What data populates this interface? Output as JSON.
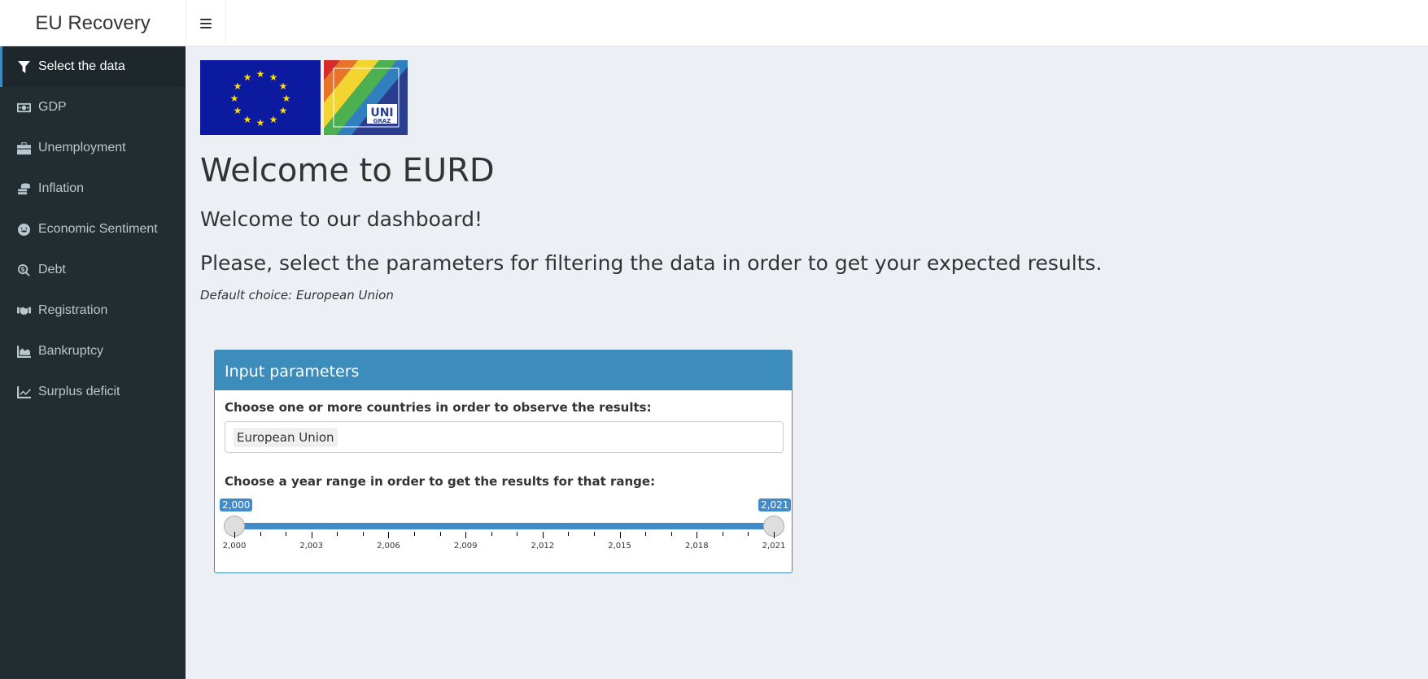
{
  "header": {
    "app_title": "EU Recovery",
    "toggle_icon": "hamburger-icon"
  },
  "sidebar": {
    "items": [
      {
        "label": "Select the data",
        "icon": "filter-icon",
        "active": true
      },
      {
        "label": "GDP",
        "icon": "money-icon",
        "active": false
      },
      {
        "label": "Unemployment",
        "icon": "briefcase-icon",
        "active": false
      },
      {
        "label": "Inflation",
        "icon": "coins-icon",
        "active": false
      },
      {
        "label": "Economic Sentiment",
        "icon": "smile-icon",
        "active": false
      },
      {
        "label": "Debt",
        "icon": "search-dollar-icon",
        "active": false
      },
      {
        "label": "Registration",
        "icon": "handshake-icon",
        "active": false
      },
      {
        "label": "Bankruptcy",
        "icon": "area-chart-icon",
        "active": false
      },
      {
        "label": "Surplus deficit",
        "icon": "line-chart-icon",
        "active": false
      }
    ]
  },
  "main": {
    "uni_logo_text_1": "UNI",
    "uni_logo_text_2": "GRAZ",
    "title": "Welcome to EURD",
    "subtitle": "Welcome to our dashboard!",
    "instruction": "Please, select the parameters for filtering the data in order to get your expected results.",
    "default_note": "Default choice: European Union"
  },
  "input_box": {
    "header": "Input parameters",
    "countries_label": "Choose one or more countries in order to observe the results:",
    "selected_countries": [
      "European Union"
    ],
    "year_label": "Choose a year range in order to get the results for that range:",
    "year_from": "2,000",
    "year_to": "2,021",
    "slider_min": 2000,
    "slider_max": 2021,
    "tick_labels": [
      "2,000",
      "2,003",
      "2,006",
      "2,009",
      "2,012",
      "2,015",
      "2,018",
      "2,021"
    ]
  },
  "colors": {
    "sidebar_bg": "#222d32",
    "accent": "#3c8dbc",
    "slider": "#428bca",
    "content_bg": "#ecf0f5"
  }
}
